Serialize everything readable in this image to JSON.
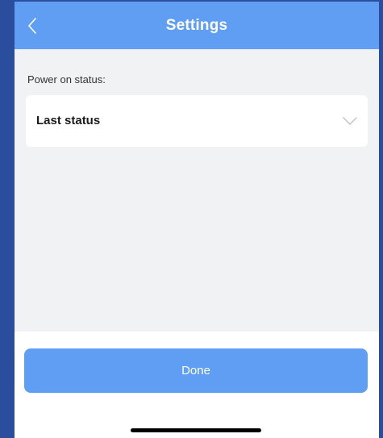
{
  "header": {
    "title": "Settings",
    "back_icon": "chevron-left-icon"
  },
  "settings": {
    "section_label": "Power on status:",
    "selected_value": "Last status",
    "dropdown_icon": "chevron-down-icon"
  },
  "footer": {
    "done_label": "Done"
  },
  "colors": {
    "accent": "#5f9ef2",
    "background": "#f1f2f4",
    "frame": "#2a4d9e"
  }
}
